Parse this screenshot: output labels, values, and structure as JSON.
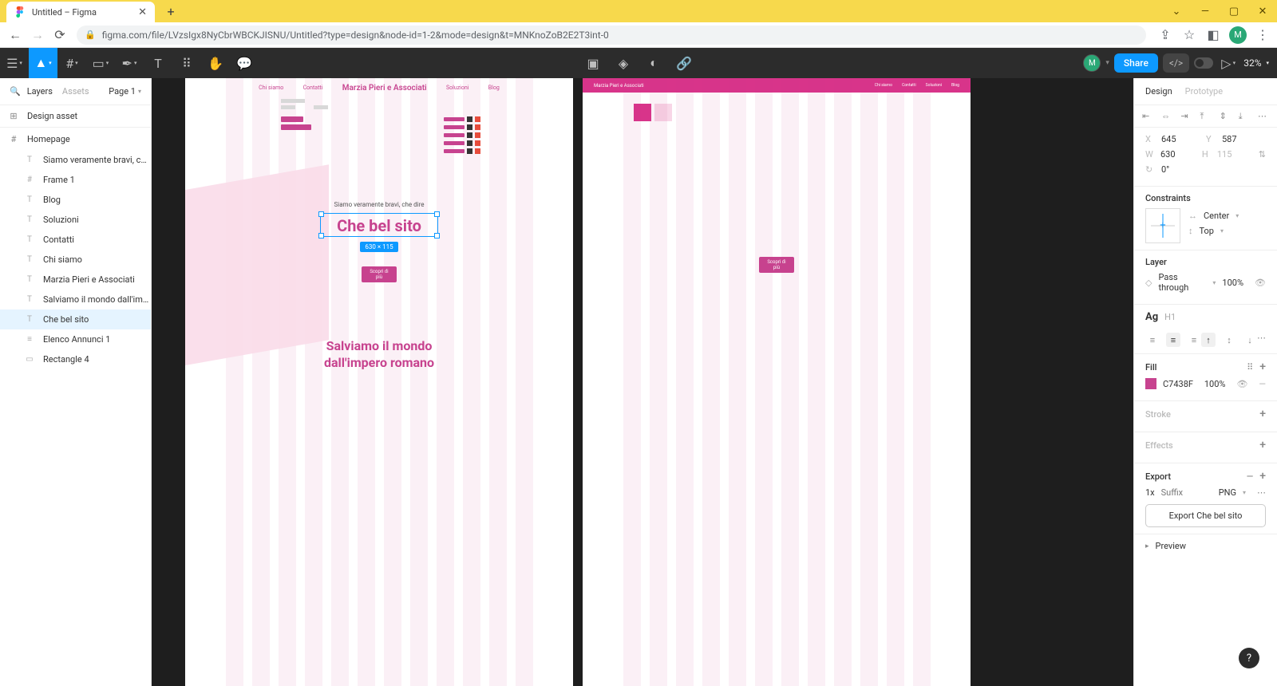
{
  "browser": {
    "tab_title": "Untitled – Figma",
    "url": "figma.com/file/LVzsIgx8NyCbrWBCKJISNU/Untitled?type=design&node-id=1-2&mode=design&t=MNKnoZoB2E2T3int-0"
  },
  "toolbar": {
    "share": "Share",
    "zoom": "32%"
  },
  "left_panel": {
    "tabs": {
      "layers": "Layers",
      "assets": "Assets"
    },
    "page": "Page 1",
    "design_asset": "Design asset",
    "homepage": "Homepage",
    "layers": [
      {
        "icon": "T",
        "label": "Siamo veramente bravi, che di..."
      },
      {
        "icon": "#",
        "label": "Frame 1"
      },
      {
        "icon": "T",
        "label": "Blog"
      },
      {
        "icon": "T",
        "label": "Soluzioni"
      },
      {
        "icon": "T",
        "label": "Contatti"
      },
      {
        "icon": "T",
        "label": "Chi siamo"
      },
      {
        "icon": "T",
        "label": "Marzia Pieri e Associati"
      },
      {
        "icon": "T",
        "label": "Salviamo il mondo dall'impero..."
      },
      {
        "icon": "T",
        "label": "Che bel sito",
        "selected": true
      },
      {
        "icon": "≡",
        "label": "Elenco Annunci 1"
      },
      {
        "icon": "▭",
        "label": "Rectangle 4"
      }
    ]
  },
  "canvas": {
    "frame1": {
      "nav": {
        "chi": "Chi siamo",
        "contatti": "Contatti",
        "brand": "Marzia Pieri e Associati",
        "soluzioni": "Soluzioni",
        "blog": "Blog"
      },
      "subtitle": "Siamo veramente bravi, che dire",
      "selected_text": "Che bel sito",
      "dim_badge": "630 × 115",
      "cta": "Scopri di più",
      "hero2_l1": "Salviamo il mondo",
      "hero2_l2": "dall'impero romano"
    },
    "frame2": {
      "brand": "Marzia Pieri e Associati",
      "links": {
        "a": "Chi siamo",
        "b": "Contatti",
        "c": "Soluzioni",
        "d": "Blog"
      },
      "cta": "Scopri di più"
    }
  },
  "right_panel": {
    "tabs": {
      "design": "Design",
      "prototype": "Prototype"
    },
    "position": {
      "x_label": "X",
      "x": "645",
      "y_label": "Y",
      "y": "587",
      "w_label": "W",
      "w": "630",
      "h_label": "H",
      "h": "115",
      "r_label": "↻",
      "r": "0°"
    },
    "constraints": {
      "title": "Constraints",
      "h": "Center",
      "v": "Top"
    },
    "layer": {
      "title": "Layer",
      "mode": "Pass through",
      "opacity": "100%"
    },
    "text": {
      "label": "Ag",
      "style": "H1"
    },
    "fill": {
      "title": "Fill",
      "hex": "C7438F",
      "opacity": "100%"
    },
    "stroke": "Stroke",
    "effects": "Effects",
    "export": {
      "title": "Export",
      "scale": "1x",
      "suffix_ph": "Suffix",
      "format": "PNG",
      "button": "Export Che bel sito"
    },
    "preview": "Preview"
  },
  "avatar_letter": "M"
}
